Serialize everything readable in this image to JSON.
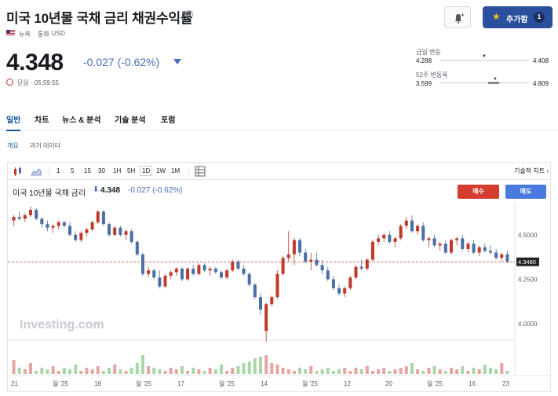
{
  "header": {
    "title": "미국 10년물 국채 금리 채권수익률",
    "info_icon": "i",
    "region": "뉴욕",
    "currency_label": "통화",
    "currency": "USD",
    "add_button": "추가함",
    "add_count": "1"
  },
  "quote": {
    "price": "4.348",
    "change": "-0.027 (-0.62%)",
    "time_label": "닫음 · 05:59:55"
  },
  "ranges": {
    "day_label": "금일 변동",
    "day_low": "4.288",
    "day_high": "4.408",
    "day_level": 0.63,
    "week52_label": "52주 변동폭",
    "week52_low": "3.599",
    "week52_high": "4.809",
    "week52_level": 0.62
  },
  "tabs": [
    "일반",
    "차트",
    "뉴스 & 분석",
    "기술 분석",
    "포럼"
  ],
  "subtabs": [
    "개요",
    "과거 데이터"
  ],
  "toolbar": {
    "timeframes": [
      "1",
      "5",
      "15",
      "30",
      "1H",
      "5H",
      "1D",
      "1W",
      "1M"
    ],
    "selected": "1D",
    "tech_chart": "기술적 차트"
  },
  "legend": {
    "name": "미국 10년물 국채 금리",
    "price": "4.348",
    "change": "-0.027 (-0.62%)",
    "sell": "매수",
    "buy": "매도"
  },
  "chart_data": {
    "type": "candlestick",
    "y_ticks": [
      "4.5000",
      "4.2500",
      "4.0000"
    ],
    "y_tick_values": [
      4.5,
      4.25,
      4.0
    ],
    "ylim": [
      3.93,
      4.68
    ],
    "current_price_label": "4.3480",
    "current_price": 4.348,
    "x_labels": [
      "21",
      "월 '25",
      "18",
      "월 '25",
      "17",
      "월 '25",
      "14",
      "월 '25",
      "12",
      "20",
      "월 '25",
      "16",
      "23"
    ],
    "watermark": "Investing.com",
    "up_color": "#c0392b",
    "down_color": "#4a6fa5",
    "volume_color_up": "#e8a3a3",
    "volume_color_down": "#a8d8a8",
    "candles": [
      [
        4.58,
        4.61,
        4.55,
        4.6
      ],
      [
        4.6,
        4.63,
        4.58,
        4.59
      ],
      [
        4.59,
        4.62,
        4.57,
        4.61
      ],
      [
        4.61,
        4.66,
        4.6,
        4.64
      ],
      [
        4.64,
        4.65,
        4.58,
        4.59
      ],
      [
        4.59,
        4.6,
        4.54,
        4.56
      ],
      [
        4.56,
        4.58,
        4.52,
        4.54
      ],
      [
        4.54,
        4.56,
        4.51,
        4.55
      ],
      [
        4.55,
        4.58,
        4.53,
        4.57
      ],
      [
        4.57,
        4.58,
        4.54,
        4.55
      ],
      [
        4.55,
        4.57,
        4.49,
        4.5
      ],
      [
        4.5,
        4.52,
        4.46,
        4.47
      ],
      [
        4.47,
        4.52,
        4.46,
        4.51
      ],
      [
        4.51,
        4.54,
        4.49,
        4.53
      ],
      [
        4.53,
        4.58,
        4.52,
        4.57
      ],
      [
        4.57,
        4.64,
        4.56,
        4.63
      ],
      [
        4.63,
        4.64,
        4.55,
        4.56
      ],
      [
        4.56,
        4.57,
        4.49,
        4.5
      ],
      [
        4.5,
        4.55,
        4.49,
        4.54
      ],
      [
        4.54,
        4.55,
        4.49,
        4.5
      ],
      [
        4.5,
        4.53,
        4.47,
        4.52
      ],
      [
        4.52,
        4.53,
        4.45,
        4.46
      ],
      [
        4.46,
        4.47,
        4.38,
        4.39
      ],
      [
        4.39,
        4.4,
        4.27,
        4.28
      ],
      [
        4.28,
        4.32,
        4.26,
        4.3
      ],
      [
        4.3,
        4.31,
        4.25,
        4.26
      ],
      [
        4.26,
        4.3,
        4.2,
        4.21
      ],
      [
        4.21,
        4.28,
        4.2,
        4.27
      ],
      [
        4.27,
        4.3,
        4.25,
        4.29
      ],
      [
        4.29,
        4.32,
        4.27,
        4.31
      ],
      [
        4.31,
        4.32,
        4.24,
        4.25
      ],
      [
        4.25,
        4.32,
        4.24,
        4.31
      ],
      [
        4.31,
        4.33,
        4.27,
        4.28
      ],
      [
        4.28,
        4.34,
        4.27,
        4.33
      ],
      [
        4.33,
        4.34,
        4.29,
        4.3
      ],
      [
        4.3,
        4.32,
        4.27,
        4.31
      ],
      [
        4.31,
        4.32,
        4.28,
        4.29
      ],
      [
        4.29,
        4.3,
        4.25,
        4.26
      ],
      [
        4.26,
        4.31,
        4.25,
        4.3
      ],
      [
        4.3,
        4.36,
        4.29,
        4.35
      ],
      [
        4.35,
        4.36,
        4.3,
        4.31
      ],
      [
        4.31,
        4.33,
        4.27,
        4.28
      ],
      [
        4.28,
        4.29,
        4.21,
        4.22
      ],
      [
        4.22,
        4.23,
        4.14,
        4.15
      ],
      [
        4.15,
        4.17,
        4.05,
        4.08
      ],
      [
        3.96,
        4.12,
        3.9,
        4.11
      ],
      [
        4.11,
        4.16,
        4.1,
        4.15
      ],
      [
        4.15,
        4.3,
        4.14,
        4.28
      ],
      [
        4.28,
        4.38,
        4.27,
        4.37
      ],
      [
        4.37,
        4.52,
        4.35,
        4.39
      ],
      [
        4.39,
        4.48,
        4.33,
        4.47
      ],
      [
        4.47,
        4.48,
        4.38,
        4.4
      ],
      [
        4.4,
        4.42,
        4.34,
        4.35
      ],
      [
        4.35,
        4.4,
        4.3,
        4.36
      ],
      [
        4.36,
        4.4,
        4.32,
        4.33
      ],
      [
        4.33,
        4.36,
        4.28,
        4.3
      ],
      [
        4.3,
        4.32,
        4.24,
        4.25
      ],
      [
        4.25,
        4.27,
        4.19,
        4.2
      ],
      [
        4.2,
        4.22,
        4.16,
        4.17
      ],
      [
        4.17,
        4.21,
        4.15,
        4.2
      ],
      [
        4.2,
        4.27,
        4.19,
        4.26
      ],
      [
        4.26,
        4.33,
        4.25,
        4.32
      ],
      [
        4.32,
        4.36,
        4.3,
        4.31
      ],
      [
        4.31,
        4.37,
        4.3,
        4.36
      ],
      [
        4.36,
        4.47,
        4.35,
        4.46
      ],
      [
        4.46,
        4.5,
        4.44,
        4.48
      ],
      [
        4.48,
        4.51,
        4.46,
        4.5
      ],
      [
        4.5,
        4.52,
        4.45,
        4.46
      ],
      [
        4.46,
        4.49,
        4.43,
        4.48
      ],
      [
        4.48,
        4.56,
        4.47,
        4.55
      ],
      [
        4.55,
        4.6,
        4.53,
        4.58
      ],
      [
        4.58,
        4.61,
        4.51,
        4.52
      ],
      [
        4.52,
        4.56,
        4.5,
        4.55
      ],
      [
        4.55,
        4.57,
        4.46,
        4.47
      ],
      [
        4.47,
        4.49,
        4.43,
        4.48
      ],
      [
        4.48,
        4.5,
        4.43,
        4.44
      ],
      [
        4.44,
        4.46,
        4.41,
        4.45
      ],
      [
        4.45,
        4.47,
        4.39,
        4.4
      ],
      [
        4.4,
        4.48,
        4.39,
        4.47
      ],
      [
        4.47,
        4.49,
        4.44,
        4.48
      ],
      [
        4.48,
        4.5,
        4.41,
        4.42
      ],
      [
        4.42,
        4.46,
        4.4,
        4.45
      ],
      [
        4.45,
        4.47,
        4.39,
        4.4
      ],
      [
        4.4,
        4.44,
        4.38,
        4.43
      ],
      [
        4.43,
        4.45,
        4.4,
        4.41
      ],
      [
        4.41,
        4.44,
        4.39,
        4.4
      ],
      [
        4.4,
        4.42,
        4.36,
        4.37
      ],
      [
        4.37,
        4.4,
        4.35,
        4.39
      ],
      [
        4.39,
        4.41,
        4.34,
        4.35
      ]
    ],
    "volumes": [
      0.45,
      0.2,
      0.15,
      0.35,
      0.1,
      0.2,
      0.15,
      0.25,
      0.1,
      0.2,
      0.15,
      0.3,
      0.1,
      0.2,
      0.15,
      0.25,
      0.1,
      0.2,
      0.3,
      0.15,
      0.1,
      0.2,
      0.35,
      0.6,
      0.25,
      0.2,
      0.15,
      0.1,
      0.2,
      0.15,
      0.25,
      0.1,
      0.2,
      0.15,
      0.1,
      0.2,
      0.15,
      0.3,
      0.1,
      0.2,
      0.25,
      0.35,
      0.4,
      0.5,
      0.55,
      0.6,
      0.35,
      0.3,
      0.2,
      0.15,
      0.1,
      0.2,
      0.15,
      0.25,
      0.1,
      0.15,
      0.2,
      0.1,
      0.15,
      0.2,
      0.1,
      0.2,
      0.15,
      0.25,
      0.1,
      0.15,
      0.2,
      0.1,
      0.15,
      0.2,
      0.25,
      0.35,
      0.15,
      0.1,
      0.2,
      0.25,
      0.15,
      0.1,
      0.2,
      0.15,
      0.25,
      0.1,
      0.2,
      0.15,
      0.3,
      0.2,
      0.15,
      0.35,
      0.1
    ]
  }
}
